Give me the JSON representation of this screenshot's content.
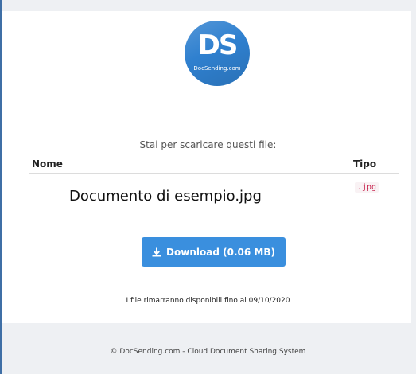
{
  "logo": {
    "letters": "DS",
    "text": "DocSending.com"
  },
  "intro": "Stai per scaricare questi file:",
  "table": {
    "headers": {
      "name": "Nome",
      "type": "Tipo"
    },
    "rows": [
      {
        "name": "Documento di esempio.jpg",
        "type": ".jpg"
      }
    ]
  },
  "download": {
    "label": "Download (0.06 MB)",
    "icon": "download-icon"
  },
  "expiry": "I file rimarranno disponibili fino al 09/10/2020",
  "footer": "© DocSending.com - Cloud Document Sharing System",
  "colors": {
    "accent": "#3a8fde",
    "logo": "#2f80cf",
    "type_badge_text": "#c7254e",
    "footer_bg": "#eef0f3"
  }
}
